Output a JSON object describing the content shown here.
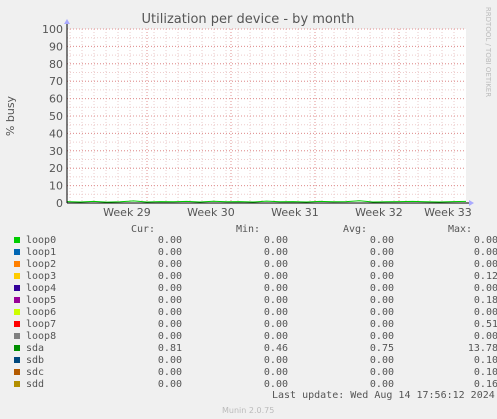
{
  "chart_data": {
    "type": "line",
    "title": "Utilization per device - by month",
    "ylabel": "% busy",
    "ylim": [
      0,
      100
    ],
    "y_ticks": [
      0,
      10,
      20,
      30,
      40,
      50,
      60,
      70,
      80,
      90,
      100
    ],
    "x_ticks": [
      "Week 29",
      "Week 30",
      "Week 31",
      "Week 32",
      "Week 33"
    ],
    "grid": true,
    "side_label": "RRDTOOL / TOBI OETIKER",
    "series": [
      {
        "name": "sda",
        "color": "#00cc00",
        "values": [
          0.8,
          0.6,
          0.9,
          0.5,
          0.7,
          1.2,
          0.6,
          0.8,
          0.7,
          0.9,
          0.6,
          1.0,
          0.7,
          0.8,
          0.6,
          1.1,
          0.7,
          0.8,
          0.6,
          0.9,
          0.7,
          0.8,
          1.3,
          0.6,
          0.7,
          0.8,
          0.9,
          0.7,
          0.6,
          0.8,
          0.9
        ]
      }
    ]
  },
  "legend": {
    "headers": {
      "cur": "Cur:",
      "min": "Min:",
      "avg": "Avg:",
      "max": "Max:"
    },
    "rows": [
      {
        "name": "loop0",
        "color": "#00cc00",
        "cur": "0.00",
        "min": "0.00",
        "avg": "0.00",
        "max": "0.00"
      },
      {
        "name": "loop1",
        "color": "#0066b3",
        "cur": "0.00",
        "min": "0.00",
        "avg": "0.00",
        "max": "0.00"
      },
      {
        "name": "loop2",
        "color": "#ff8000",
        "cur": "0.00",
        "min": "0.00",
        "avg": "0.00",
        "max": "0.00"
      },
      {
        "name": "loop3",
        "color": "#ffcc00",
        "cur": "0.00",
        "min": "0.00",
        "avg": "0.00",
        "max": "0.12"
      },
      {
        "name": "loop4",
        "color": "#330099",
        "cur": "0.00",
        "min": "0.00",
        "avg": "0.00",
        "max": "0.00"
      },
      {
        "name": "loop5",
        "color": "#990099",
        "cur": "0.00",
        "min": "0.00",
        "avg": "0.00",
        "max": "0.18"
      },
      {
        "name": "loop6",
        "color": "#ccff00",
        "cur": "0.00",
        "min": "0.00",
        "avg": "0.00",
        "max": "0.00"
      },
      {
        "name": "loop7",
        "color": "#ff0000",
        "cur": "0.00",
        "min": "0.00",
        "avg": "0.00",
        "max": "0.51"
      },
      {
        "name": "loop8",
        "color": "#808080",
        "cur": "0.00",
        "min": "0.00",
        "avg": "0.00",
        "max": "0.00"
      },
      {
        "name": "sda",
        "color": "#008f00",
        "cur": "0.81",
        "min": "0.46",
        "avg": "0.75",
        "max": "13.78"
      },
      {
        "name": "sdb",
        "color": "#00487d",
        "cur": "0.00",
        "min": "0.00",
        "avg": "0.00",
        "max": "0.10"
      },
      {
        "name": "sdc",
        "color": "#b35a00",
        "cur": "0.00",
        "min": "0.00",
        "avg": "0.00",
        "max": "0.10"
      },
      {
        "name": "sdd",
        "color": "#b38f00",
        "cur": "0.00",
        "min": "0.00",
        "avg": "0.00",
        "max": "0.16"
      }
    ]
  },
  "footer": {
    "last_update": "Last update:  Wed Aug 14 17:56:12 2024",
    "munin": "Munin 2.0.75"
  }
}
